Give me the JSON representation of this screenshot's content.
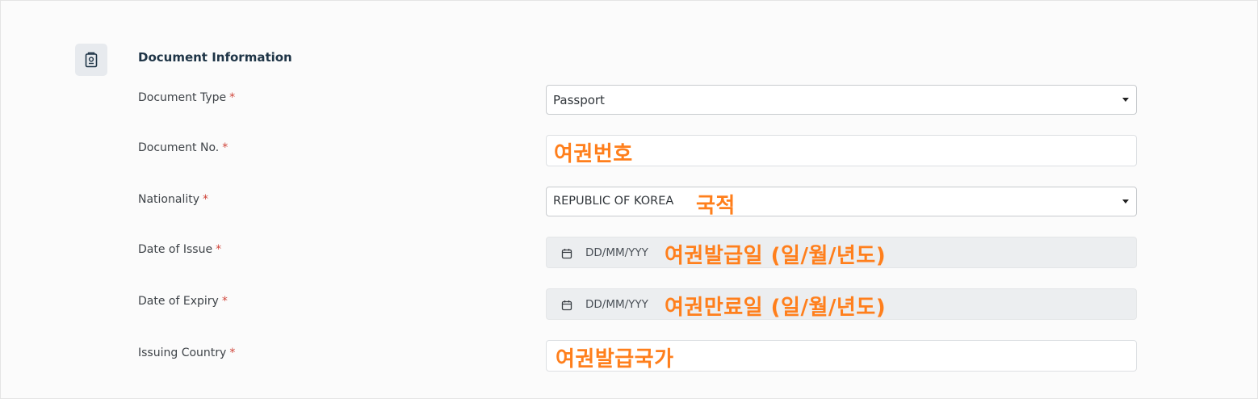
{
  "section": {
    "title": "Document Information",
    "icon": "passport-icon"
  },
  "fields": {
    "document_type": {
      "label": "Document Type",
      "required_mark": "*",
      "value": "Passport"
    },
    "document_no": {
      "label": "Document No.",
      "required_mark": "*",
      "value": ""
    },
    "nationality": {
      "label": "Nationality",
      "required_mark": "*",
      "value": "REPUBLIC OF KOREA"
    },
    "date_of_issue": {
      "label": "Date of Issue",
      "required_mark": "*",
      "placeholder": "DD/MM/YYY"
    },
    "date_of_expiry": {
      "label": "Date of Expiry",
      "required_mark": "*",
      "placeholder": "DD/MM/YYY"
    },
    "issuing_country": {
      "label": "Issuing Country",
      "required_mark": "*",
      "value": ""
    }
  },
  "annotations": {
    "document_no": "여권번호",
    "nationality": "국적",
    "date_of_issue": "여권발급일 (일/월/년도)",
    "date_of_expiry": "여권만료일 (일/월/년도)",
    "issuing_country": "여권발급국가"
  },
  "colors": {
    "annotation": "#ff7f1c",
    "required": "#d0453a",
    "title": "#1e3446",
    "date_field_bg": "#eceef0"
  }
}
